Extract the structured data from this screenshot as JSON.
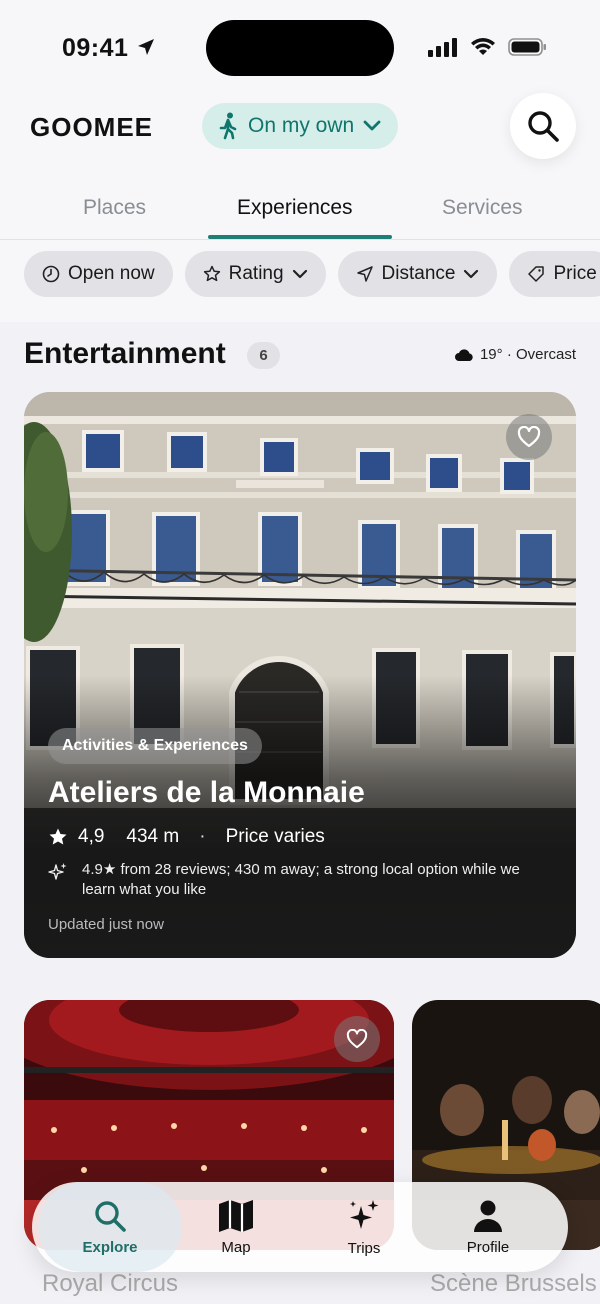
{
  "status_bar": {
    "time": "09:41"
  },
  "header": {
    "brand": "GOOMEE",
    "mode_label": "On my own"
  },
  "tabs": [
    {
      "label": "Places",
      "active": false
    },
    {
      "label": "Experiences",
      "active": true
    },
    {
      "label": "Services",
      "active": false
    }
  ],
  "filters": [
    {
      "label": "Open now",
      "icon": "clock-icon"
    },
    {
      "label": "Rating",
      "icon": "star-outline-icon",
      "dropdown": true
    },
    {
      "label": "Distance",
      "icon": "navigation-icon",
      "dropdown": true
    },
    {
      "label": "Price",
      "icon": "tag-icon"
    }
  ],
  "section": {
    "title": "Entertainment",
    "count": "6",
    "weather": "19° · Overcast"
  },
  "featured": {
    "category": "Activities & Experiences",
    "name": "Ateliers de la Monnaie",
    "rating": "4,9",
    "distance": "434 m",
    "price": "Price varies",
    "ai_note": "4.9★ from 28 reviews; 430 m away; a strong local option while we learn what you like",
    "updated": "Updated just now"
  },
  "more_cards": [
    {
      "name": "Royal Circus"
    },
    {
      "name": "Scène Brussels"
    }
  ],
  "nav": [
    {
      "label": "Explore",
      "icon": "search-icon",
      "active": true
    },
    {
      "label": "Map",
      "icon": "map-icon",
      "active": false
    },
    {
      "label": "Trips",
      "icon": "sparkles-icon",
      "active": false
    },
    {
      "label": "Profile",
      "icon": "person-icon",
      "active": false
    }
  ],
  "colors": {
    "accent": "#1f7e76",
    "pill_bg": "#d6eeea",
    "background": "#f2f2f6"
  }
}
